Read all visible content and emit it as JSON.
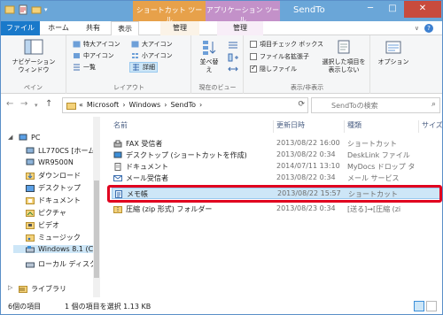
{
  "window": {
    "title": "SendTo",
    "context_tab_shortcut": "ショートカット ツール",
    "context_tab_app": "アプリケーション ツール",
    "minimize": "─",
    "maximize": "□",
    "close": "✕"
  },
  "tabs": {
    "file": "ファイル",
    "home": "ホーム",
    "share": "共有",
    "view": "表示",
    "manage_shortcut": "管理",
    "manage_app": "管理"
  },
  "ribbon": {
    "pane": {
      "nav_pane_line1": "ナビゲーション",
      "nav_pane_line2": "ウィンドウ",
      "label": "ペイン"
    },
    "layout": {
      "items": [
        "特大アイコン",
        "大アイコン",
        "中アイコン",
        "小アイコン",
        "一覧",
        "詳細"
      ],
      "selected": "詳細",
      "label": "レイアウト"
    },
    "current_view": {
      "sort_line1": "並べ替",
      "sort_line2": "え",
      "label": "現在のビュー"
    },
    "show_hide": {
      "item_checkbox": "項目チェック ボックス",
      "file_ext": "ファイル名拡張子",
      "hidden_files": "隠しファイル",
      "hide_selected_line1": "選択した項目を",
      "hide_selected_line2": "表示しない",
      "label": "表示/非表示"
    },
    "options": "オプション"
  },
  "address": {
    "back": "←",
    "forward": "→",
    "up": "↑",
    "path": [
      "«",
      "Microsoft",
      "›",
      "Windows",
      "›",
      "SendTo",
      "›"
    ],
    "refresh": "⟳",
    "search_placeholder": "SendToの検索",
    "search_icon": "⌕"
  },
  "nav": {
    "items": [
      {
        "label": "PC",
        "icon": "pc-icon"
      },
      {
        "label": "LL770CS [ホーム",
        "icon": "computer-icon"
      },
      {
        "label": "WR9500N",
        "icon": "computer-icon"
      },
      {
        "label": "ダウンロード",
        "icon": "download-folder-icon"
      },
      {
        "label": "デスクトップ",
        "icon": "desktop-folder-icon"
      },
      {
        "label": "ドキュメント",
        "icon": "documents-folder-icon"
      },
      {
        "label": "ピクチャ",
        "icon": "pictures-folder-icon"
      },
      {
        "label": "ビデオ",
        "icon": "videos-folder-icon"
      },
      {
        "label": "ミュージック",
        "icon": "music-folder-icon"
      },
      {
        "label": "Windows 8.1 (C",
        "icon": "drive-icon"
      },
      {
        "label": "ローカル ディスク (D",
        "icon": "drive-icon"
      },
      {
        "label": "ライブラリ",
        "icon": "library-icon"
      }
    ]
  },
  "list": {
    "headers": {
      "name": "名前",
      "date": "更新日時",
      "type": "種類",
      "size": "サイズ"
    },
    "rows": [
      {
        "name": "FAX 受信者",
        "date": "2013/08/22 16:00",
        "type": "ショートカット",
        "icon": "fax-icon"
      },
      {
        "name": "デスクトップ (ショートカットを作成)",
        "date": "2013/08/22 0:34",
        "type": "DeskLink ファイル",
        "icon": "desktop-link-icon"
      },
      {
        "name": "ドキュメント",
        "date": "2014/07/11 13:10",
        "type": "MyDocs ドロップ タ",
        "icon": "documents-icon"
      },
      {
        "name": "メール受信者",
        "date": "2013/08/22 0:34",
        "type": "メール サービス",
        "icon": "mail-icon"
      },
      {
        "name": "メモ帳",
        "date": "2013/08/22 15:57",
        "type": "ショートカット",
        "icon": "notepad-icon"
      },
      {
        "name": "圧縮 (zip 形式) フォルダー",
        "date": "2013/08/23 0:34",
        "type": "[送る]→[圧縮 (zi",
        "icon": "zip-folder-icon"
      }
    ],
    "selected_index": 4
  },
  "status": {
    "count": "6個の項目",
    "selection": "1 個の項目を選択  1.13 KB"
  },
  "colors": {
    "title_bar": "#6aa6d8",
    "file_tab": "#1979ca",
    "shortcut_tools": "#e7a14a",
    "app_tools": "#c391c9",
    "selection": "#cde6f7",
    "highlight_box": "#e0001f"
  }
}
